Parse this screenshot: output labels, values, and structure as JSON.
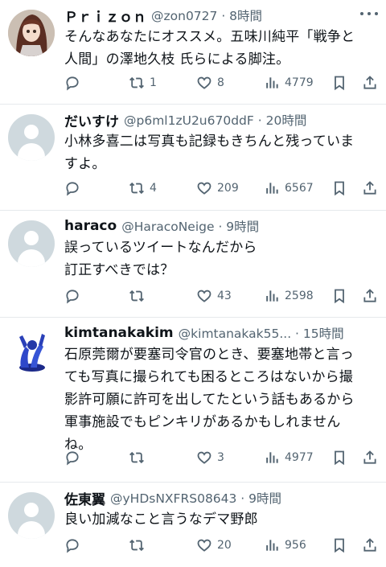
{
  "colors": {
    "text": "#0f1419",
    "secondary": "#536471",
    "divider": "#e6e9ec",
    "default_avatar": "#cfd9de"
  },
  "tweets": [
    {
      "name": "Ｐｒｉｚｏｎ",
      "handle": "@zon0727 · 8時間",
      "text": "そんなあなたにオススメ。五味川純平「戦争と\n人間」の澤地久枝 氏らによる脚注。",
      "reply_count": "",
      "retweet_count": "1",
      "like_count": "8",
      "view_count": "4779",
      "avatar": "doll-photo"
    },
    {
      "name": "だいすけ",
      "handle": "@p6ml1zU2u670ddF · 20時間",
      "text": "小林多喜二は写真も記録もきちんと残っていま\nすよ。",
      "reply_count": "",
      "retweet_count": "4",
      "like_count": "209",
      "view_count": "6567",
      "avatar": "default"
    },
    {
      "name": "haraco",
      "handle": "@HaracoNeige · 9時間",
      "text": "誤っているツイートなんだから\n訂正すべきでは？",
      "reply_count": "",
      "retweet_count": "",
      "like_count": "43",
      "view_count": "2598",
      "avatar": "default"
    },
    {
      "name": "kimtanakakim",
      "handle": "@kimtanakak55... · 15時間",
      "text": "石原莞爾が要塞司令官のとき、要塞地帯と言っ\nても写真に撮られても困るところはないから撮\n影許可願に許可を出してたという話もあるから\n軍事施設でもピンキリがあるかもしれません\nね。",
      "reply_count": "",
      "retweet_count": "",
      "like_count": "3",
      "view_count": "4977",
      "avatar": "blue-figure"
    },
    {
      "name": "佐東翼",
      "handle": "@yHDsNXFRS08643 · 9時間",
      "text": "良い加減なこと言うなデマ野郎",
      "reply_count": "",
      "retweet_count": "",
      "like_count": "20",
      "view_count": "956",
      "avatar": "default"
    }
  ]
}
